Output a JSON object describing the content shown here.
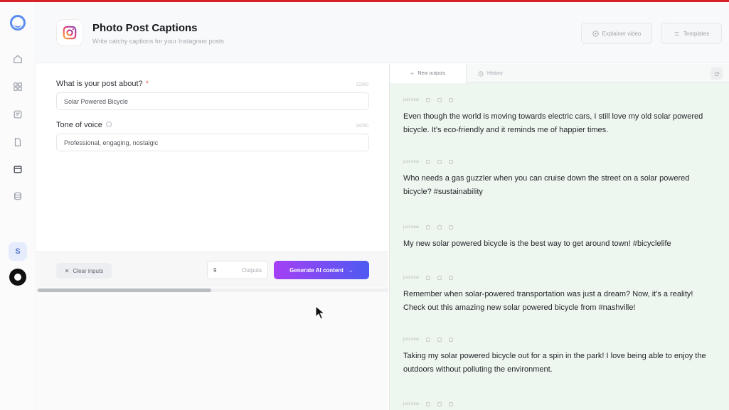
{
  "header": {
    "title": "Photo Post Captions",
    "subtitle": "Write catchy captions for your Instagram posts",
    "explainer_label": "Explainer video",
    "templates_label": "Templates"
  },
  "sidebar": {
    "avatar_letter": "S",
    "items": [
      "home-icon",
      "grid-icon",
      "notes-icon",
      "document-icon",
      "calendar-icon",
      "storage-icon"
    ]
  },
  "form": {
    "post_about_label": "What is your post about?",
    "post_about_required": "*",
    "post_about_count": "22/80",
    "post_about_value": "Solar Powered Bicycle",
    "tone_label": "Tone of voice",
    "tone_count": "34/80",
    "tone_value": "Professional, engaging, nostalgic",
    "clear_label": "Clear inputs",
    "outputs_value": "9",
    "outputs_label": "Outputs",
    "generate_label": "Generate AI content",
    "generate_arrow": "→"
  },
  "outputs": {
    "tab_new": "New outputs",
    "tab_history": "History",
    "items": [
      {
        "time": "just now",
        "text": "Even though the world is moving towards electric cars, I still love my old solar powered bicycle. It's eco-friendly and it reminds me of happier times."
      },
      {
        "time": "just now",
        "text": "Who needs a gas guzzler when you can cruise down the street on a solar powered bicycle? #sustainability"
      },
      {
        "time": "just now",
        "text": "My new solar powered bicycle is the best way to get around town! #bicyclelife"
      },
      {
        "time": "just now",
        "text": "Remember when solar-powered transportation was just a dream? Now, it's a reality! Check out this amazing new solar powered bicycle from #nashville!"
      },
      {
        "time": "just now",
        "text": "Taking my solar powered bicycle out for a spin in the park! I love being able to enjoy the outdoors without polluting the environment."
      },
      {
        "time": "just now",
        "text": ""
      }
    ]
  },
  "colors": {
    "accent_top": "#d81f26",
    "generate_start": "#a53ff5",
    "generate_end": "#4e5af1",
    "output_bg": "#eef7ef"
  }
}
